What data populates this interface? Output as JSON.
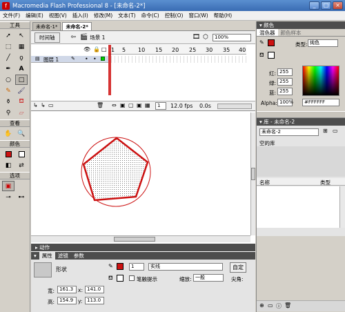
{
  "window": {
    "title": "Macromedia Flash Professional 8 - [未命名-2*]",
    "min": "_",
    "max": "□",
    "close": "×"
  },
  "menu": [
    "文件(F)",
    "编辑(E)",
    "视图(V)",
    "插入(I)",
    "修改(M)",
    "文本(T)",
    "命令(C)",
    "控制(O)",
    "窗口(W)",
    "帮助(H)"
  ],
  "toolbox": {
    "tools_title": "工具",
    "view_title": "查看",
    "colors_title": "颜色",
    "options_title": "选项"
  },
  "document": {
    "tabs": [
      "未命名-1*",
      "未命名-2*"
    ],
    "timeline_button": "时间轴",
    "scene": "场景 1",
    "zoom": "100%",
    "layer_name": "图层 1",
    "ruler_marks": [
      "1",
      "5",
      "10",
      "15",
      "20",
      "25",
      "30",
      "35",
      "40"
    ],
    "current_frame": "1",
    "fps": "12.0 fps",
    "time": "0.0s"
  },
  "panels": {
    "actions": "动作",
    "properties": {
      "tabs": [
        "属性",
        "滤镜",
        "参数"
      ],
      "type": "形状",
      "width_label": "宽:",
      "width": "161.3",
      "x_label": "x:",
      "x": "141.0",
      "height_label": "高:",
      "height": "154.9",
      "y_label": "y:",
      "y": "113.0",
      "stroke_size": "1",
      "stroke_style": "实线",
      "custom_button": "自定",
      "hint_label": "笔触提示",
      "scale_label": "缩放:",
      "scale": "一般",
      "cap_label": "尖角:"
    }
  },
  "color_panel": {
    "title": "颜色",
    "tabs": [
      "混色器",
      "颜色样本"
    ],
    "type_label": "类型:",
    "type": "纯色",
    "red_label": "红:",
    "red": "255",
    "green_label": "绿:",
    "green": "255",
    "blue_label": "蓝:",
    "blue": "255",
    "alpha_label": "Alpha:",
    "alpha": "100%",
    "hex": "#FFFFFF"
  },
  "library_panel": {
    "title": "库 - 未命名-2",
    "selector": "未命名-2",
    "empty_text": "空的库",
    "col_name": "名称",
    "col_type": "类型"
  },
  "colors": {
    "stroke": "#cc1111",
    "fill": "#dddddd",
    "accent": "#3a6cb3"
  }
}
